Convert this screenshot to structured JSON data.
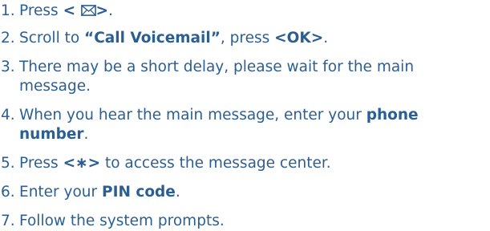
{
  "steps": [
    {
      "num": "1.",
      "before": "Press ",
      "key_open": "<",
      "key_close": ">",
      "after": "."
    },
    {
      "num": "2.",
      "before": "Scroll to ",
      "bold1": "“Call Voicemail”",
      "mid": ", press ",
      "bold2": "<OK>",
      "after": "."
    },
    {
      "num": "3.",
      "text": "There may be a short delay, please wait for the main message."
    },
    {
      "num": "4.",
      "before": "When you hear the main message, enter your ",
      "bold1": "phone number",
      "after": "."
    },
    {
      "num": "5.",
      "before": "Press ",
      "bold1": "<∗>",
      "after": " to access the message center."
    },
    {
      "num": "6.",
      "before": "Enter your ",
      "bold1": "PIN code",
      "after": "."
    },
    {
      "num": "7.",
      "text": "Follow the system prompts."
    }
  ],
  "icons": {
    "step1_key": "envelope-icon"
  },
  "colors": {
    "text": "#2b5f93"
  }
}
